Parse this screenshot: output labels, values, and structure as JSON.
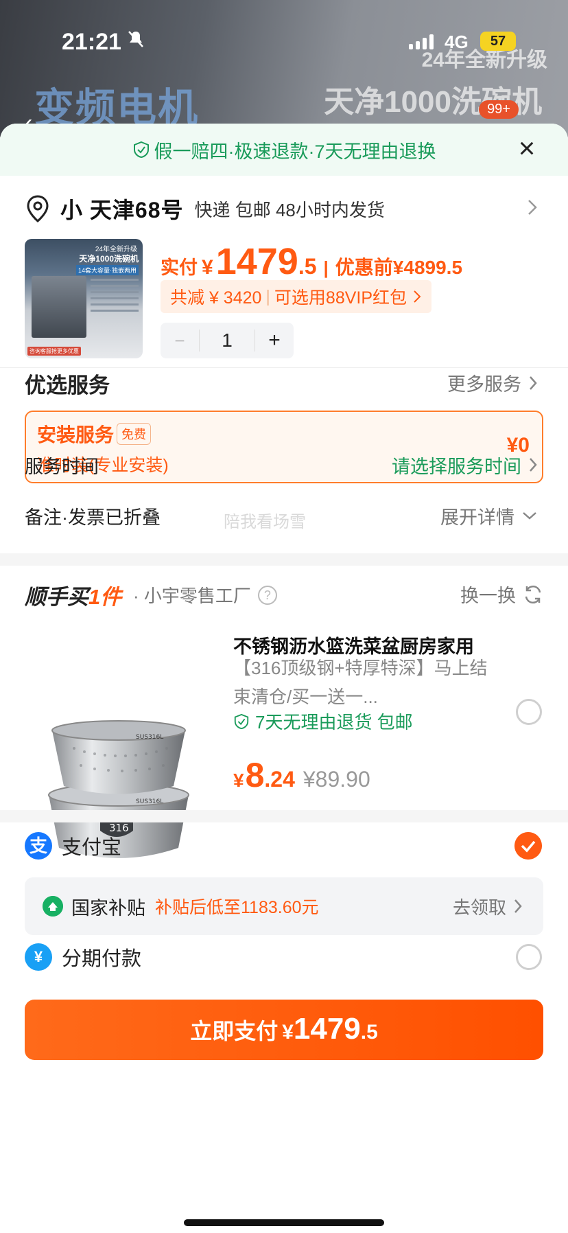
{
  "status": {
    "time": "21:21",
    "network": "4G",
    "battery": "57"
  },
  "banner": {
    "big_text": "变频电机",
    "subtitle1": "24年全新升级",
    "subtitle2": "天净1000洗碗机",
    "badge": "99+"
  },
  "sheet": {
    "guarantee": "假一赔四·极速退款·7天无理由退换",
    "address": {
      "name": "小 天津68号",
      "shipping": "快递 包邮 48小时内发货"
    },
    "product": {
      "image_text": {
        "t1": "24年全新升级",
        "t2": "天净1000洗碗机",
        "t3": "14套大容量·独嵌两用",
        "foot": "咨询客服抢更多优惠"
      },
      "pay_label": "实付",
      "currency": "¥",
      "price_int": "1479",
      "price_dec": ".5",
      "before_label": "优惠前¥4899.5",
      "discount": "共减 ¥ 3420",
      "vip": "可选用88VIP红包",
      "quantity": "1",
      "minus": "−",
      "plus": "+"
    },
    "services": {
      "heading": "优选服务",
      "more": "更多服务",
      "install_title": "安装服务",
      "install_free": "免费",
      "install_desc": "准时装(专业安装)",
      "install_price": "¥0",
      "time_label": "服务时间",
      "time_action": "请选择服务时间",
      "remark_label": "备注·发票已折叠",
      "remark_action": "展开详情",
      "watermark": "陪我看场雪"
    },
    "addon": {
      "logo_a": "顺手买",
      "logo_b": "1件",
      "shop": "· 小宇零售工厂",
      "swap": "换一换",
      "title": "不锈钢沥水篮洗菜盆厨房家用",
      "desc": "【316顶级钢+特厚特深】马上结束清仓/买一送一...",
      "tag": "7天无理由退货 包邮",
      "currency": "¥",
      "price_int": "8",
      "price_dec": ".24",
      "orig": "¥89.90",
      "bowl_text": {
        "label": "SUS316L",
        "shield": "316"
      }
    },
    "payment": {
      "alipay": "支付宝",
      "alipay_icon": "支",
      "subsidy_name": "国家补贴",
      "subsidy_value": "补贴后低至1183.60元",
      "subsidy_go": "去领取",
      "installment": "分期付款",
      "installment_icon": "¥"
    },
    "pay_button": {
      "label": "立即支付",
      "currency": "¥",
      "int": "1479",
      "dec": ".5"
    }
  }
}
